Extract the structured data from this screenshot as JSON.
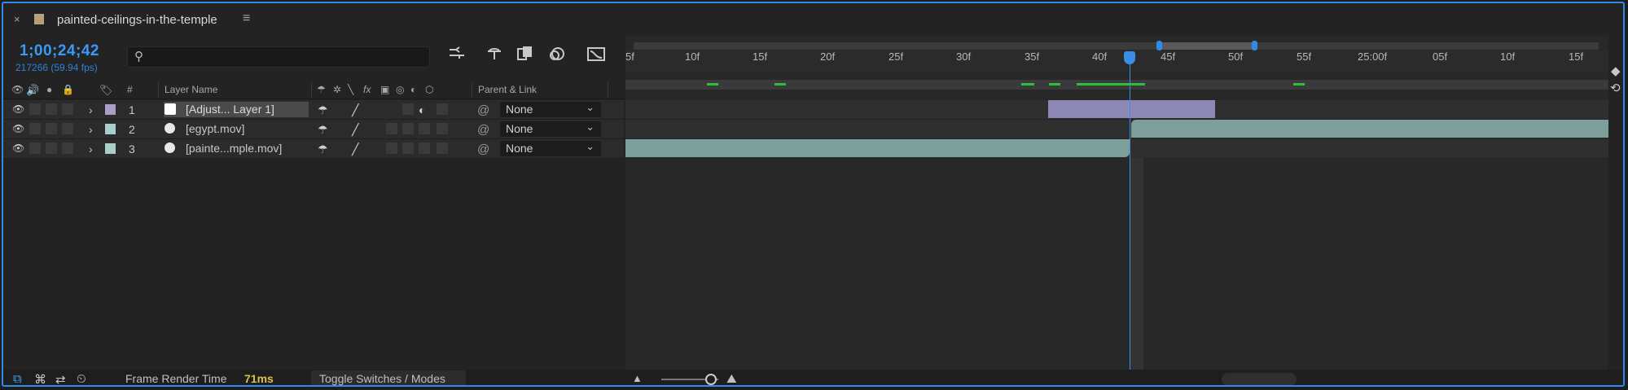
{
  "tab": {
    "close": "×",
    "title": "painted-ceilings-in-the-temple",
    "menu": "≡",
    "swatch_color": "#b79f7b"
  },
  "header": {
    "timecode": "1;00;24;42",
    "framecount": "217266 (59.94 fps)",
    "search_placeholder": ""
  },
  "columns": {
    "hash": "#",
    "layer_name": "Layer Name",
    "parent_link": "Parent & Link",
    "fx": "fx"
  },
  "layers": [
    {
      "num": "1",
      "name": "[Adjust... Layer 1]",
      "parent": "None",
      "label_color": "#a89ec8",
      "type": "adjustment",
      "selected": true
    },
    {
      "num": "2",
      "name": "[egypt.mov]",
      "parent": "None",
      "label_color": "#a9cfca",
      "type": "movie",
      "selected": false
    },
    {
      "num": "3",
      "name": "[painte...mple.mov]",
      "parent": "None",
      "label_color": "#a9cfca",
      "type": "movie",
      "selected": false
    }
  ],
  "ruler": {
    "ticks": [
      "5f",
      "10f",
      "15f",
      "20f",
      "25f",
      "30f",
      "35f",
      "40f",
      "45f",
      "50f",
      "55f",
      "25:00f",
      "05f",
      "10f",
      "15f"
    ]
  },
  "bottom": {
    "render_label": "Frame Render Time",
    "render_value": "71ms",
    "toggle_label": "Toggle Switches / Modes"
  },
  "colors": {
    "accent": "#2d8ceb",
    "timecode": "#3a9af7",
    "cache": "#2bbf3a",
    "render_time": "#e0c046"
  }
}
